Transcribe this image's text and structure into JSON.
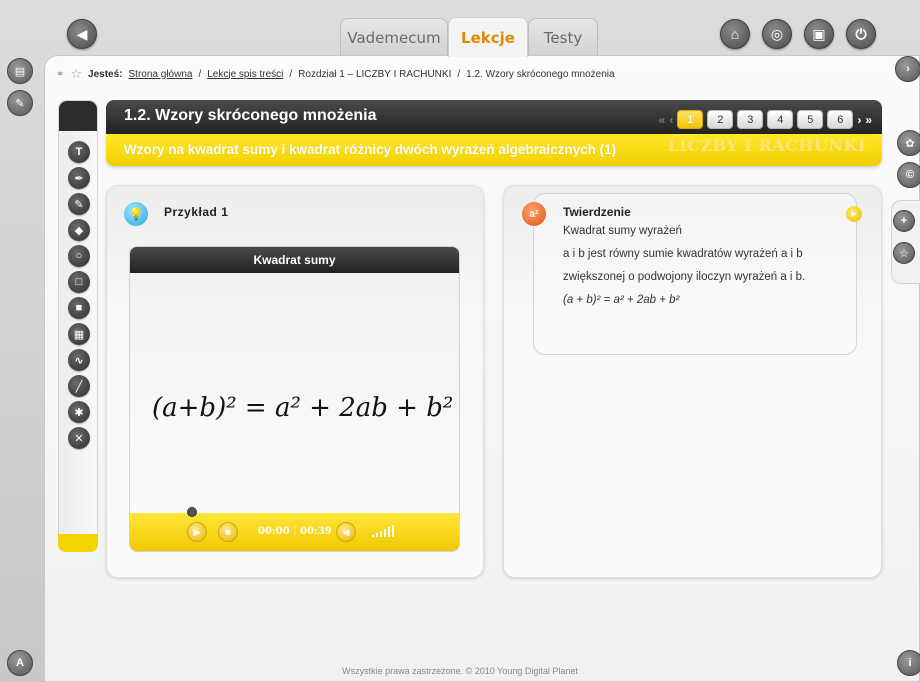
{
  "tabs": [
    {
      "label": "Vademecum",
      "active": false
    },
    {
      "label": "Lekcje",
      "active": true
    },
    {
      "label": "Testy",
      "active": false
    }
  ],
  "top_icons": [
    "home-icon",
    "refresh-icon",
    "window-icon",
    "power-icon"
  ],
  "breadcrumb": {
    "prefix": "Jesteś:",
    "items": [
      "Strona główna",
      "Lekcje spis treści",
      "Rozdział 1 – LICZBY I RACHUNKI",
      "1.2. Wzory skróconego mnożenia"
    ],
    "separator": "/"
  },
  "lesson": {
    "title": "1.2. Wzory skróconego mnożenia",
    "subtitle": "Wzory na kwadrat sumy i kwadrat różnicy dwóch wyrażeń algebraicznych (1)",
    "chapter_watermark": "LICZBY I RACHUNKI"
  },
  "pager": {
    "pages": [
      "1",
      "2",
      "3",
      "4",
      "5",
      "6"
    ],
    "current": "1",
    "first": "«",
    "prev": "‹",
    "next": "›",
    "last": "»"
  },
  "toolbar_tools": [
    "text-tool-icon",
    "pen-tool-icon",
    "marker-tool-icon",
    "eraser-tool-icon",
    "circle-tool-icon",
    "square-tool-icon",
    "filled-square-tool-icon",
    "dashed-rect-tool-icon",
    "wave-tool-icon",
    "line-tool-icon",
    "star-tool-icon",
    "close-tool-icon"
  ],
  "example": {
    "label": "Przykład 1",
    "player_title": "Kwadrat sumy",
    "formula": "(a+b)² = a² + 2ab + b²",
    "time_current": "00:00",
    "time_total": "00:39",
    "playback_progress": 0.0
  },
  "theorem": {
    "title": "Twierdzenie",
    "line1": "Kwadrat sumy wyrażeń",
    "line2": "a i b jest równy sumie kwadratów wyrażeń a i b",
    "line3": "zwiększonej o podwojony iloczyn wyrażeń a i b.",
    "formula": "(a + b)² = a² + 2ab + b²"
  },
  "footer": "Wszystkie prawa zastrzeżone. © 2010 Young Digital Planet",
  "colors": {
    "accent_yellow": "#f2cf00",
    "dark_bar": "#222222",
    "tab_active": "#e08a00"
  }
}
